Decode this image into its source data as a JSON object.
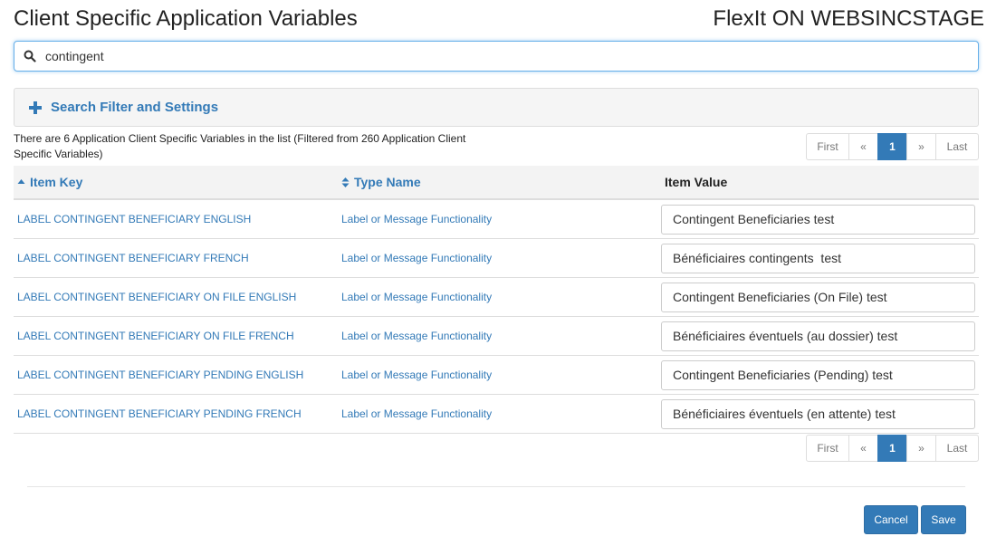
{
  "header": {
    "title": "Client Specific Application Variables",
    "environment": "FlexIt ON WEBSINCSTAGE"
  },
  "search": {
    "value": "contingent",
    "icon": "search-icon"
  },
  "filter_panel": {
    "label": "Search Filter and Settings",
    "icon": "plus-icon"
  },
  "summary": "There are 6 Application Client Specific Variables in the list (Filtered from 260 Application Client Specific Variables)",
  "pagination": {
    "first": "First",
    "prev": "«",
    "current": "1",
    "next": "»",
    "last": "Last"
  },
  "table": {
    "columns": [
      "Item Key",
      "Type Name",
      "Item Value"
    ],
    "rows": [
      {
        "key": "LABEL CONTINGENT BENEFICIARY ENGLISH",
        "type": "Label or Message Functionality",
        "value": "Contingent Beneficiaries test"
      },
      {
        "key": "LABEL CONTINGENT BENEFICIARY FRENCH",
        "type": "Label or Message Functionality",
        "value": "Bénéficiaires contingents  test"
      },
      {
        "key": "LABEL CONTINGENT BENEFICIARY ON FILE ENGLISH",
        "type": "Label or Message Functionality",
        "value": "Contingent Beneficiaries (On File) test"
      },
      {
        "key": "LABEL CONTINGENT BENEFICIARY ON FILE FRENCH",
        "type": "Label or Message Functionality",
        "value": "Bénéficiaires éventuels (au dossier) test"
      },
      {
        "key": "LABEL CONTINGENT BENEFICIARY PENDING ENGLISH",
        "type": "Label or Message Functionality",
        "value": "Contingent Beneficiaries (Pending) test"
      },
      {
        "key": "LABEL CONTINGENT BENEFICIARY PENDING FRENCH",
        "type": "Label or Message Functionality",
        "value": "Bénéficiaires éventuels (en attente) test"
      }
    ]
  },
  "actions": {
    "cancel": "Cancel",
    "save": "Save"
  },
  "colors": {
    "primary": "#337ab7",
    "focus_border": "#66afe9"
  }
}
